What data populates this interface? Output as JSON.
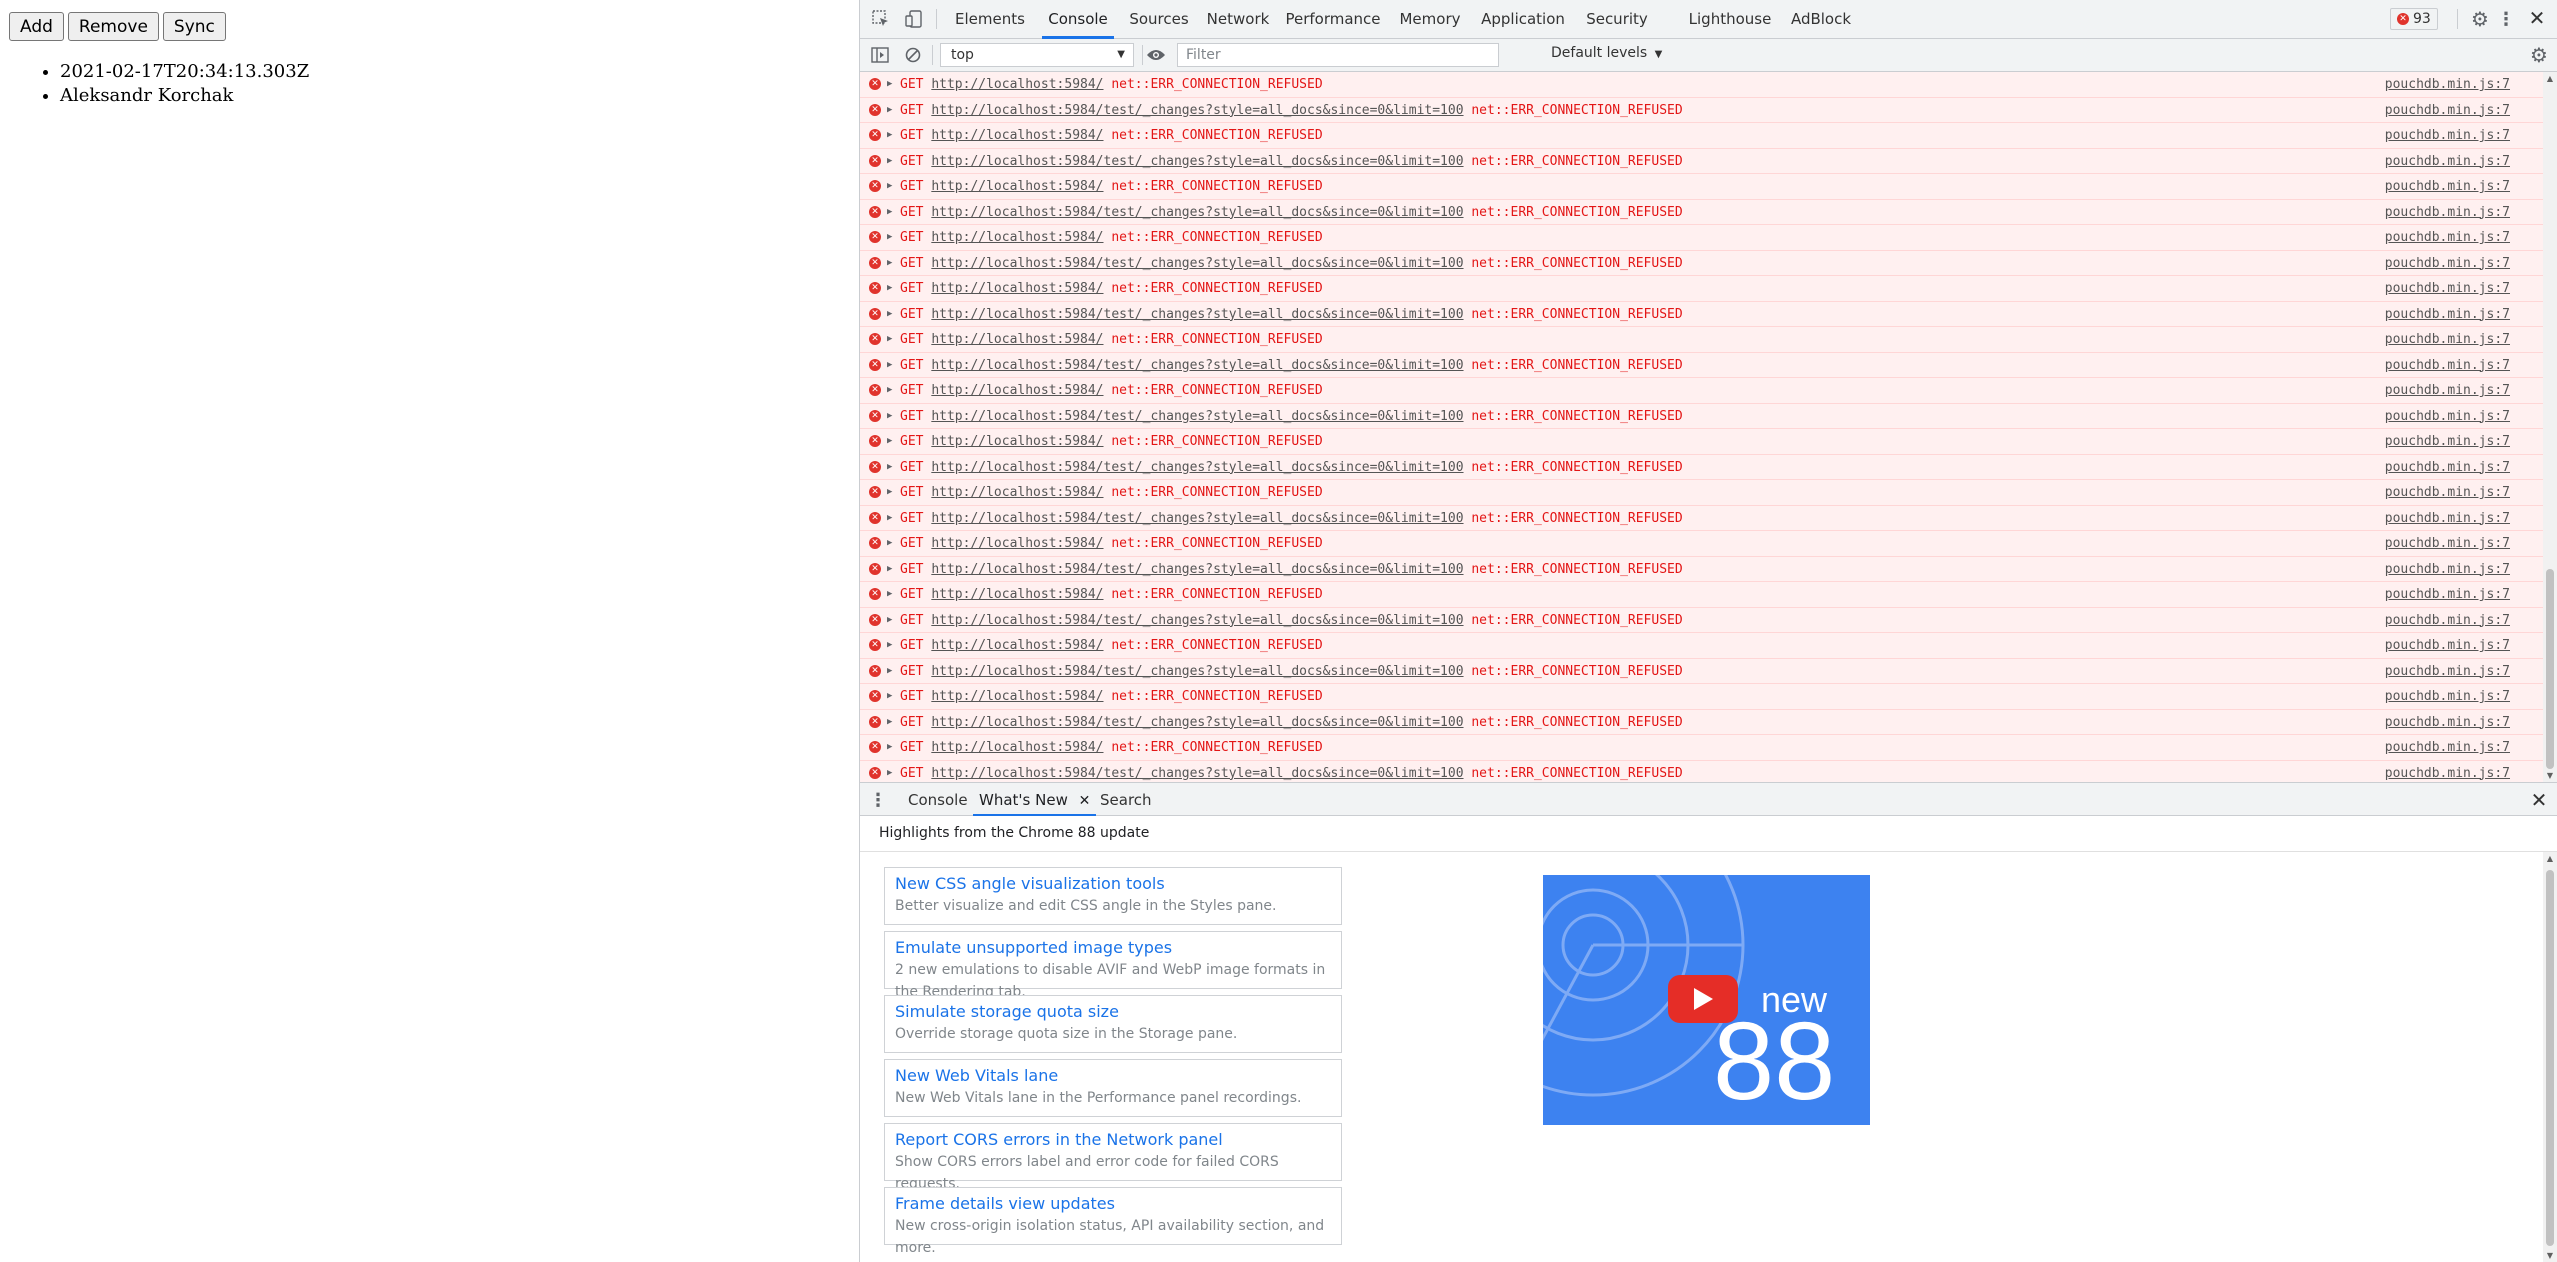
{
  "page": {
    "buttons": [
      "Add",
      "Remove",
      "Sync"
    ],
    "list": [
      "2021-02-17T20:34:13.303Z",
      "Aleksandr Korchak"
    ]
  },
  "devtools": {
    "tabs": [
      "Elements",
      "Console",
      "Sources",
      "Network",
      "Performance",
      "Memory",
      "Application",
      "Security",
      "Lighthouse",
      "AdBlock"
    ],
    "active_tab": "Console",
    "error_count": "93",
    "context": "top",
    "filter_placeholder": "Filter",
    "levels": "Default levels",
    "log_method": "GET",
    "log_error": "net::ERR_CONNECTION_REFUSED",
    "log_source": "pouchdb.min.js:7",
    "log_urls": [
      "http://localhost:5984/",
      "http://localhost:5984/test/_changes?style=all_docs&since=0&limit=100",
      "http://localhost:5984/",
      "http://localhost:5984/test/_changes?style=all_docs&since=0&limit=100",
      "http://localhost:5984/",
      "http://localhost:5984/test/_changes?style=all_docs&since=0&limit=100",
      "http://localhost:5984/",
      "http://localhost:5984/test/_changes?style=all_docs&since=0&limit=100",
      "http://localhost:5984/",
      "http://localhost:5984/test/_changes?style=all_docs&since=0&limit=100",
      "http://localhost:5984/",
      "http://localhost:5984/test/_changes?style=all_docs&since=0&limit=100",
      "http://localhost:5984/",
      "http://localhost:5984/test/_changes?style=all_docs&since=0&limit=100",
      "http://localhost:5984/",
      "http://localhost:5984/test/_changes?style=all_docs&since=0&limit=100",
      "http://localhost:5984/",
      "http://localhost:5984/test/_changes?style=all_docs&since=0&limit=100",
      "http://localhost:5984/",
      "http://localhost:5984/test/_changes?style=all_docs&since=0&limit=100",
      "http://localhost:5984/",
      "http://localhost:5984/test/_changes?style=all_docs&since=0&limit=100",
      "http://localhost:5984/",
      "http://localhost:5984/test/_changes?style=all_docs&since=0&limit=100",
      "http://localhost:5984/",
      "http://localhost:5984/test/_changes?style=all_docs&since=0&limit=100",
      "http://localhost:5984/",
      "http://localhost:5984/test/_changes?style=all_docs&since=0&limit=100"
    ],
    "prompt": "›",
    "drawer": {
      "tabs": [
        "Console",
        "What's New",
        "Search"
      ],
      "active_tab": "What's New",
      "header": "Highlights from the Chrome 88 update",
      "items": [
        {
          "title": "New CSS angle visualization tools",
          "desc": "Better visualize and edit CSS angle in the Styles pane."
        },
        {
          "title": "Emulate unsupported image types",
          "desc": "2 new emulations to disable AVIF and WebP image formats in the Rendering tab."
        },
        {
          "title": "Simulate storage quota size",
          "desc": "Override storage quota size in the Storage pane."
        },
        {
          "title": "New Web Vitals lane",
          "desc": "New Web Vitals lane in the Performance panel recordings."
        },
        {
          "title": "Report CORS errors in the Network panel",
          "desc": "Show CORS errors label and error code for failed CORS requests."
        },
        {
          "title": "Frame details view updates",
          "desc": "New cross-origin isolation status, API availability section, and more."
        }
      ],
      "video": {
        "word": "new",
        "number": "88"
      }
    }
  },
  "colors": {
    "accent": "#1a73e8",
    "error_text": "#e31616",
    "error_bg": "#fff0f0",
    "video_bg": "#3d82f0",
    "play_red": "#e52d27"
  },
  "icons": [
    "inspect-icon",
    "device-toggle-icon",
    "error-badge-icon",
    "settings-gear-icon",
    "kebab-menu-icon",
    "close-icon",
    "sidebar-toggle-icon",
    "clear-console-icon",
    "eye-icon",
    "console-settings-icon",
    "expand-triangle-icon",
    "drawer-menu-icon",
    "play-icon"
  ]
}
